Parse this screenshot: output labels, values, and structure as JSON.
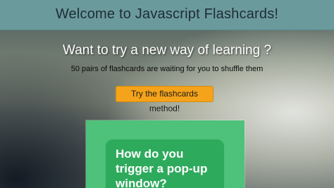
{
  "header": {
    "title": "Welcome to Javascript Flashcards!"
  },
  "hero": {
    "title": "Want to try a new way of learning ?",
    "subtitle": "50 pairs of flashcards are waiting for you to shuffle them",
    "cta_label": "Try the flashcards method!"
  },
  "flashcard": {
    "question": "How do you trigger a pop-up window?"
  },
  "colors": {
    "header_bg": "#6b9a9d",
    "cta_bg": "#f5a31a",
    "deck_bg": "#4ec17a",
    "card_bg": "#2eaa5c"
  }
}
